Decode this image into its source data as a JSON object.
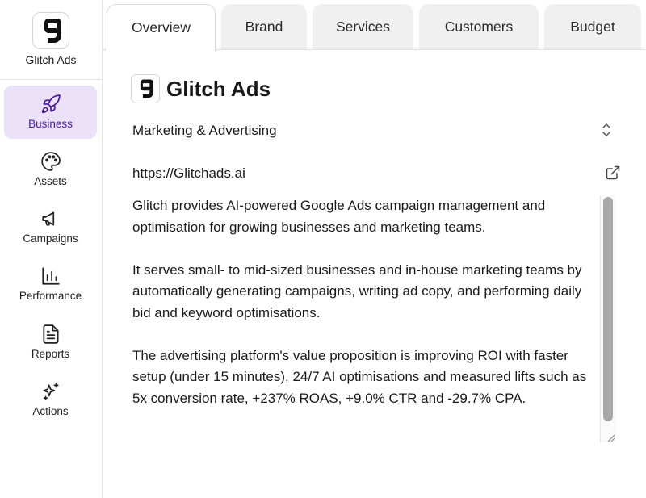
{
  "brand": {
    "name": "Glitch Ads",
    "logo_letter": "g"
  },
  "sidebar": {
    "items": [
      {
        "label": "Business",
        "icon": "rocket-icon",
        "active": true
      },
      {
        "label": "Assets",
        "icon": "palette-icon",
        "active": false
      },
      {
        "label": "Campaigns",
        "icon": "megaphone-icon",
        "active": false
      },
      {
        "label": "Performance",
        "icon": "bar-chart-icon",
        "active": false
      },
      {
        "label": "Reports",
        "icon": "document-icon",
        "active": false
      },
      {
        "label": "Actions",
        "icon": "sparkle-icon",
        "active": false
      }
    ]
  },
  "tabs": [
    {
      "label": "Overview",
      "active": true
    },
    {
      "label": "Brand",
      "active": false
    },
    {
      "label": "Services",
      "active": false
    },
    {
      "label": "Customers",
      "active": false
    },
    {
      "label": "Budget",
      "active": false
    }
  ],
  "business": {
    "title": "Glitch Ads",
    "industry": "Marketing & Advertising",
    "website": "https://Glitchads.ai",
    "description": [
      "Glitch provides AI-powered Google Ads campaign management and optimisation for growing businesses and marketing teams.",
      "It serves small- to mid-sized businesses and in-house marketing teams by automatically generating campaigns, writing ad copy, and performing daily bid and keyword optimisations.",
      "The advertising platform's value proposition is improving ROI with faster setup (under 15 minutes), 24/7 AI optimisations and measured lifts such as 5x conversion rate, +237% ROAS, +9.0% CTR and -29.7% CPA."
    ]
  },
  "colors": {
    "accent": "#4a1aa5",
    "active_bg": "#ebe1f8",
    "tab_bg": "#f0f0f1"
  }
}
